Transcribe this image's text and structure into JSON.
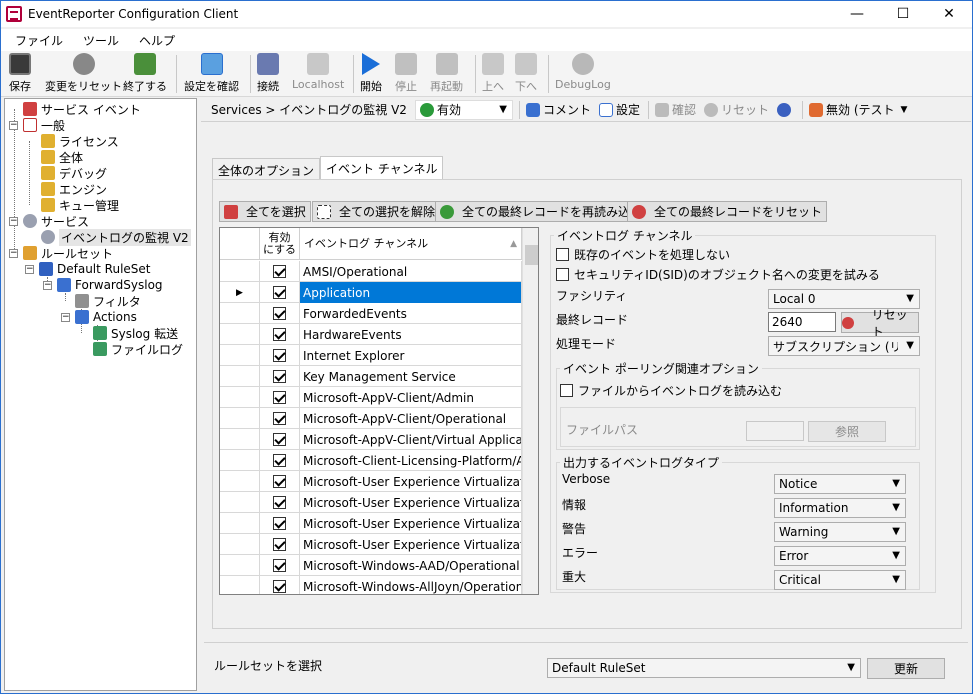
{
  "window": {
    "title": "EventReporter Configuration Client",
    "minimize": "—",
    "maximize": "☐",
    "close": "✕"
  },
  "menu": [
    "ファイル",
    "ツール",
    "ヘルプ"
  ],
  "toolbar": {
    "save": "保存",
    "reset_changes": "変更をリセット",
    "exit": "終了する",
    "check_settings": "設定を確認",
    "connect": "接続",
    "localhost": "Localhost",
    "start": "開始",
    "stop": "停止",
    "restart": "再起動",
    "up": "上へ",
    "down": "下へ",
    "debuglog": "DebugLog"
  },
  "tree": {
    "service_event": "サービス イベント",
    "general": "一般",
    "license": "ライセンス",
    "all": "全体",
    "debug": "デバッグ",
    "engine": "エンジン",
    "queue": "キュー管理",
    "services": "サービス",
    "eventlog_monitor": "イベントログの監視 V2",
    "ruleset": "ルールセット",
    "default_ruleset": "Default RuleSet",
    "forward_syslog": "ForwardSyslog",
    "filter": "フィルタ",
    "actions": "Actions",
    "syslog_forward": "Syslog 転送",
    "file_log": "ファイルログ"
  },
  "navbar": {
    "breadcrumb": "Services > イベントログの監視 V2",
    "state": "有効",
    "comment": "コメント",
    "settings": "設定",
    "confirm": "確認",
    "reset": "リセット",
    "mode": "無効 (テスト"
  },
  "tabs": {
    "global_options": "全体のオプション",
    "event_channels": "イベント チャンネル"
  },
  "actions": {
    "select_all": "全てを選択",
    "deselect_all": "全ての選択を解除",
    "reload_last": "全ての最終レコードを再読み込み",
    "reset_last": "全ての最終レコードをリセット"
  },
  "grid": {
    "col_enabled": "有効\nにする",
    "col_channel": "イベントログ チャンネル",
    "rows": [
      {
        "name": "AMSI/Operational",
        "checked": true
      },
      {
        "name": "Application",
        "checked": true,
        "selected": true
      },
      {
        "name": "ForwardedEvents",
        "checked": true
      },
      {
        "name": "HardwareEvents",
        "checked": true
      },
      {
        "name": "Internet Explorer",
        "checked": true
      },
      {
        "name": "Key Management Service",
        "checked": true
      },
      {
        "name": "Microsoft-AppV-Client/Admin",
        "checked": true
      },
      {
        "name": "Microsoft-AppV-Client/Operational",
        "checked": true
      },
      {
        "name": "Microsoft-AppV-Client/Virtual Applicati",
        "checked": true
      },
      {
        "name": "Microsoft-Client-Licensing-Platform/Ad",
        "checked": true
      },
      {
        "name": "Microsoft-User Experience Virtualizatio",
        "checked": true
      },
      {
        "name": "Microsoft-User Experience Virtualizatio",
        "checked": true
      },
      {
        "name": "Microsoft-User Experience Virtualizatio",
        "checked": true
      },
      {
        "name": "Microsoft-User Experience Virtualizatio",
        "checked": true
      },
      {
        "name": "Microsoft-Windows-AAD/Operational",
        "checked": true
      },
      {
        "name": "Microsoft-Windows-AllJoyn/Operational",
        "checked": true
      }
    ]
  },
  "right": {
    "group_title": "イベントログ チャンネル",
    "process_existing": "既存のイベントを処理しない",
    "sid_change": "セキュリティID(SID)のオブジェクト名への変更を試みる",
    "facility_label": "ファシリティ",
    "facility_value": "Local 0",
    "last_record_label": "最終レコード",
    "last_record_value": "2640",
    "reset_btn": "リセット",
    "mode_label": "処理モード",
    "mode_value": "サブスクリプション (リアルタイ...",
    "polling_group": "イベント ポーリング関連オプション",
    "read_from_file": "ファイルからイベントログを読み込む",
    "file_path_label": "ファイルパス",
    "browse_btn": "参照",
    "types_group": "出力するイベントログタイプ",
    "types": [
      {
        "label": "Verbose",
        "value": "Notice"
      },
      {
        "label": "情報",
        "value": "Information"
      },
      {
        "label": "警告",
        "value": "Warning"
      },
      {
        "label": "エラー",
        "value": "Error"
      },
      {
        "label": "重大",
        "value": "Critical"
      }
    ]
  },
  "bottom": {
    "select_ruleset": "ルールセットを選択",
    "ruleset_value": "Default RuleSet",
    "update_btn": "更新"
  }
}
